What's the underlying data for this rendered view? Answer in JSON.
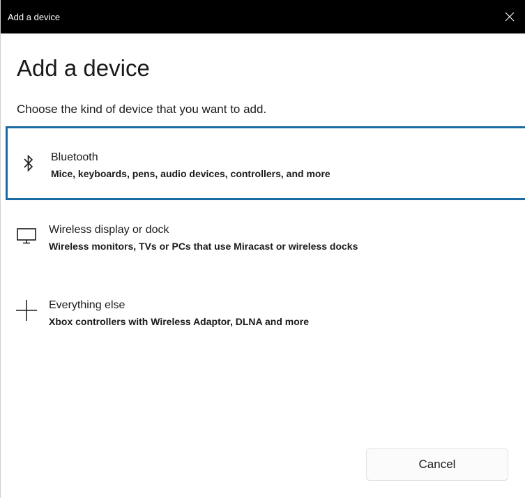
{
  "window": {
    "title": "Add a device"
  },
  "heading": "Add a device",
  "subtitle": "Choose the kind of device that you want to add.",
  "options": [
    {
      "icon": "bluetooth-icon",
      "title": "Bluetooth",
      "description": "Mice, keyboards, pens, audio devices, controllers, and more",
      "selected": true
    },
    {
      "icon": "monitor-icon",
      "title": "Wireless display or dock",
      "description": "Wireless monitors, TVs or PCs that use Miracast or wireless docks",
      "selected": false
    },
    {
      "icon": "plus-icon",
      "title": "Everything else",
      "description": "Xbox controllers with Wireless Adaptor, DLNA and more",
      "selected": false
    }
  ],
  "buttons": {
    "cancel": "Cancel"
  },
  "colors": {
    "titlebar": "#000000",
    "selection_border": "#1c6aa3",
    "background": "#ffffff"
  }
}
